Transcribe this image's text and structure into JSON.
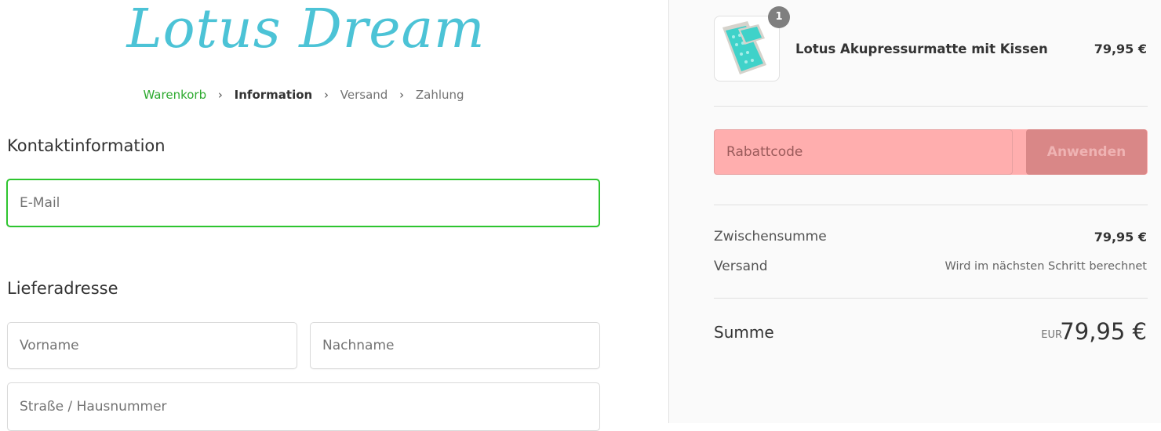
{
  "brand": {
    "logo_text": "Lotus Dream",
    "logo_color": "#4cc3d6"
  },
  "breadcrumb": {
    "items": [
      {
        "label": "Warenkorb",
        "state": "done"
      },
      {
        "label": "Information",
        "state": "current"
      },
      {
        "label": "Versand",
        "state": "upcoming"
      },
      {
        "label": "Zahlung",
        "state": "upcoming"
      }
    ],
    "separator_icon": "chevron-right-icon"
  },
  "contact": {
    "heading": "Kontaktinformation",
    "email": {
      "placeholder": "E-Mail",
      "value": ""
    }
  },
  "shipping_address": {
    "heading": "Lieferadresse",
    "first_name": {
      "placeholder": "Vorname",
      "value": ""
    },
    "last_name": {
      "placeholder": "Nachname",
      "value": ""
    },
    "street": {
      "placeholder": "Straße / Hausnummer",
      "value": ""
    }
  },
  "order_summary": {
    "product": {
      "name": "Lotus Akupressurmatte mit Kissen",
      "price": "79,95 €",
      "quantity_badge": "1",
      "image_icon": "acupressure-mat-image"
    },
    "discount": {
      "placeholder": "Rabattcode",
      "value": "",
      "apply_label": "Anwenden"
    },
    "subtotal": {
      "label": "Zwischensumme",
      "value": "79,95 €"
    },
    "shipping": {
      "label": "Versand",
      "value": "Wird im nächsten Schritt berechnet"
    },
    "total": {
      "label": "Summe",
      "currency": "EUR",
      "value": "79,95 €"
    }
  },
  "colors": {
    "accent_green": "#2ec52f",
    "discount_bg": "#ffaeae",
    "apply_bg": "#d98787"
  }
}
